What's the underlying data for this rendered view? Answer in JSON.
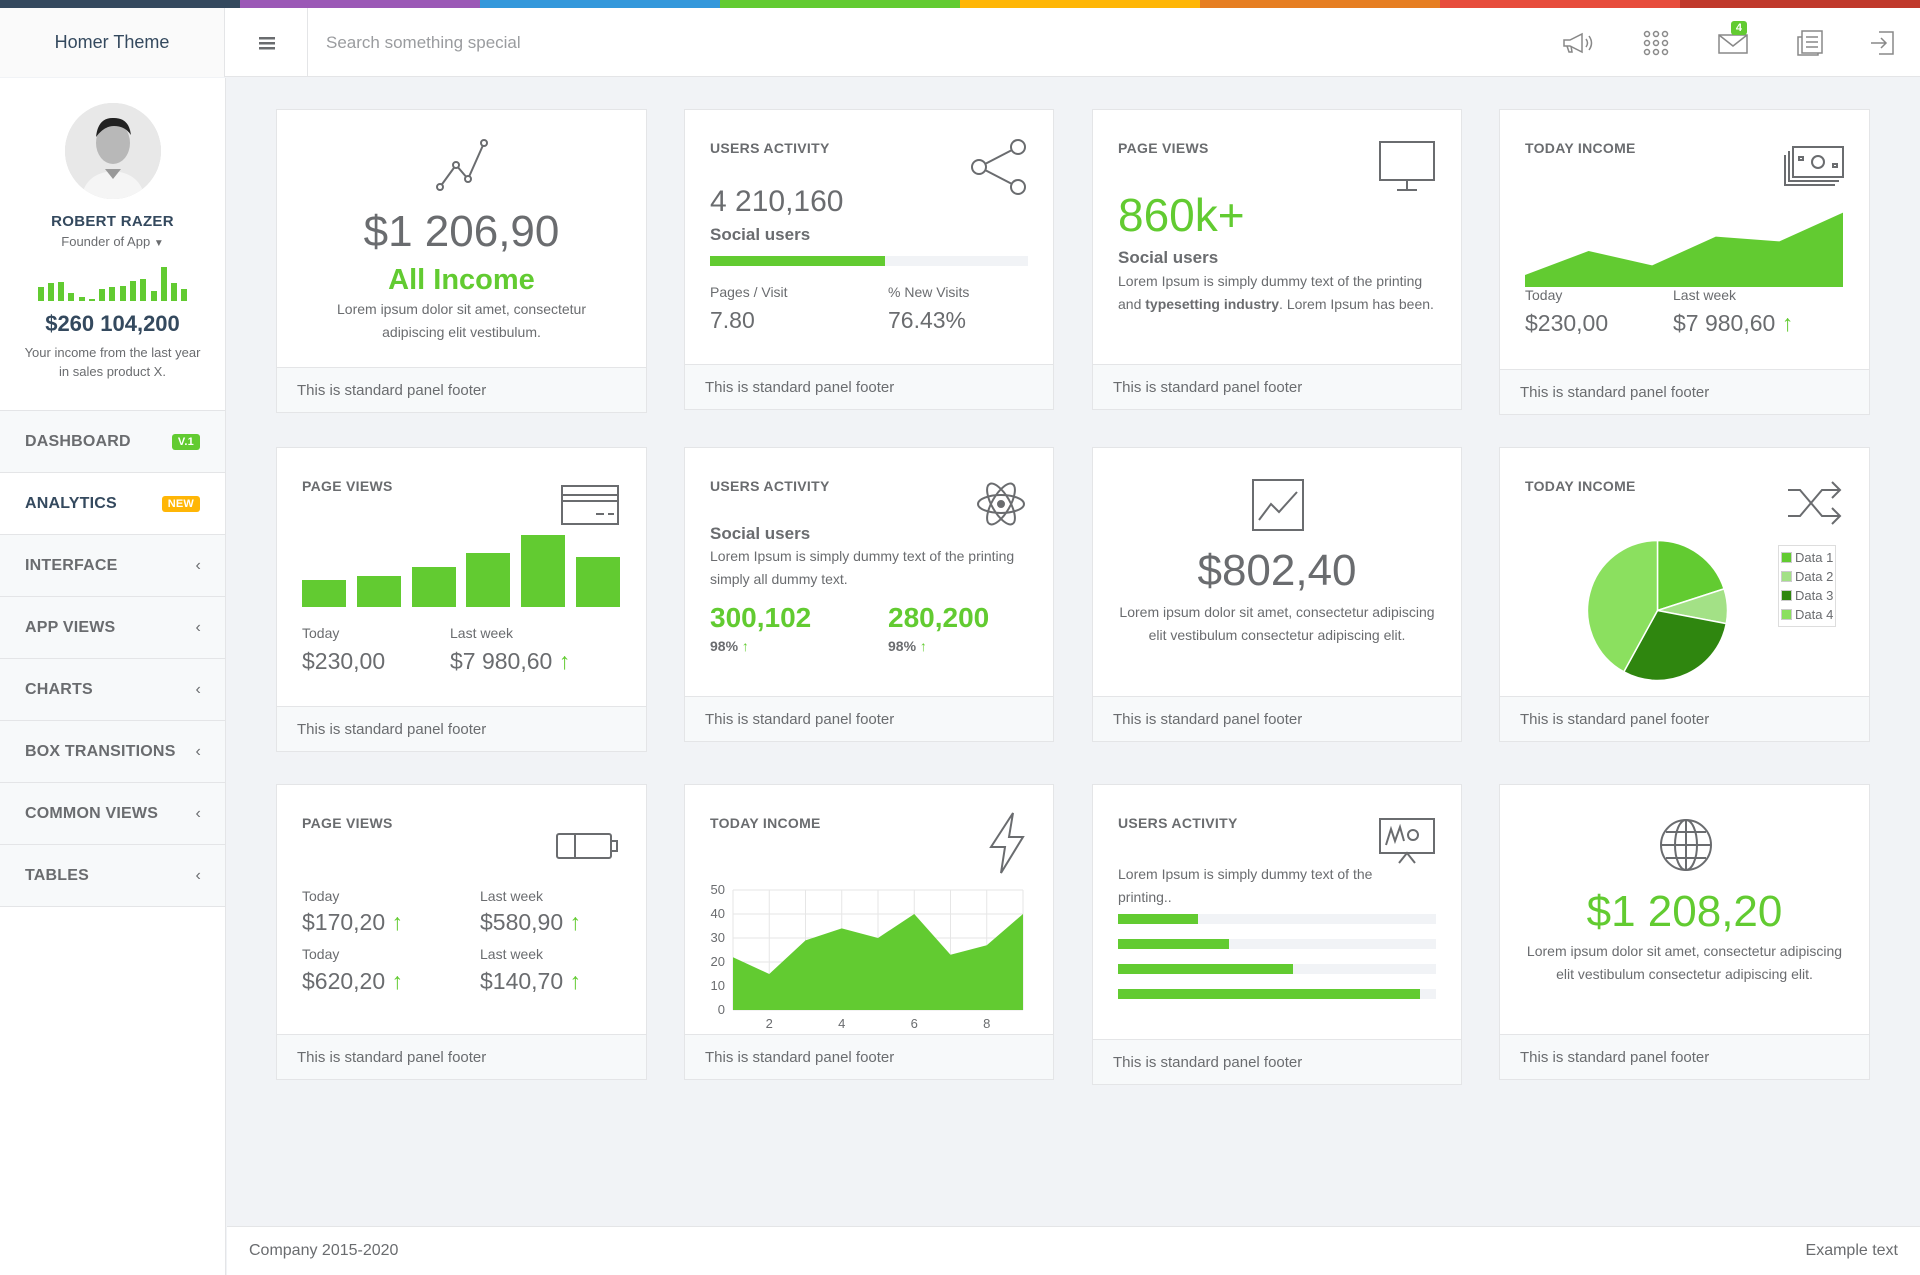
{
  "colorbar": [
    "#34495e",
    "#9b59b6",
    "#3498db",
    "#62cb31",
    "#ffb606",
    "#e67e22",
    "#e74c3c",
    "#c0392b"
  ],
  "header": {
    "brand": "Homer Theme",
    "search_placeholder": "Search something special",
    "mail_badge": "4"
  },
  "profile": {
    "name": "ROBERT RAZER",
    "role": "Founder of App",
    "income": "$260 104,200",
    "description": "Your income from the last year in sales product X.",
    "sparkline": [
      14,
      18,
      19,
      8,
      4,
      2,
      12,
      14,
      15,
      20,
      22,
      10,
      34,
      18,
      12
    ]
  },
  "nav": [
    {
      "label": "DASHBOARD",
      "badge": "V.1",
      "badge_color": "#62cb31"
    },
    {
      "label": "ANALYTICS",
      "badge": "NEW",
      "badge_color": "#ffb606"
    },
    {
      "label": "INTERFACE",
      "chevron": "‹"
    },
    {
      "label": "APP VIEWS",
      "chevron": "‹"
    },
    {
      "label": "CHARTS",
      "chevron": "‹"
    },
    {
      "label": "BOX TRANSITIONS",
      "chevron": "‹"
    },
    {
      "label": "COMMON VIEWS",
      "chevron": "‹"
    },
    {
      "label": "TABLES",
      "chevron": "‹"
    }
  ],
  "panel_footer": "This is standard panel footer",
  "p1": {
    "amount": "$1 206,90",
    "title": "All Income",
    "text": "Lorem ipsum dolor sit amet, consectetur adipiscing elit vestibulum."
  },
  "p2": {
    "title": "USERS ACTIVITY",
    "count": "4 210,160",
    "subtitle": "Social users",
    "progress": 0.55,
    "stat1_label": "Pages / Visit",
    "stat1_value": "7.80",
    "stat2_label": "% New Visits",
    "stat2_value": "76.43%"
  },
  "p3": {
    "title": "PAGE VIEWS",
    "value": "860k+",
    "subtitle": "Social users",
    "text_a": "Lorem Ipsum is simply dummy text of the printing and ",
    "text_b": "typesetting industry",
    "text_c": ". Lorem Ipsum has been."
  },
  "p4": {
    "title": "TODAY INCOME",
    "today_label": "Today",
    "today_value": "$230,00",
    "week_label": "Last week",
    "week_value": "$7 980,60",
    "area": [
      10,
      30,
      18,
      42,
      38,
      62
    ]
  },
  "p5": {
    "title": "PAGE VIEWS",
    "bars": [
      27,
      31,
      40,
      54,
      72,
      50
    ],
    "today_label": "Today",
    "today_value": "$230,00",
    "week_label": "Last week",
    "week_value": "$7 980,60"
  },
  "p6": {
    "title": "USERS ACTIVITY",
    "subtitle": "Social users",
    "text": "Lorem Ipsum is simply dummy text of the printing simply all dummy text.",
    "v1": "300,102",
    "p1": "98%",
    "v2": "280,200",
    "p2": "98%"
  },
  "p7": {
    "amount": "$802,40",
    "text": "Lorem ipsum dolor sit amet, consectetur adipiscing elit vestibulum consectetur adipiscing elit."
  },
  "p8": {
    "title": "TODAY INCOME",
    "legend": [
      "Data 1",
      "Data 2",
      "Data 3",
      "Data 4"
    ],
    "pie_colors": [
      "#62cb31",
      "#a3e186",
      "#2f860f",
      "#8be05f"
    ],
    "pie_values": [
      20,
      8,
      30,
      42
    ]
  },
  "p9": {
    "title": "PAGE VIEWS",
    "r1_l1": "Today",
    "r1_v1": "$170,20",
    "r1_l2": "Last week",
    "r1_v2": "$580,90",
    "r2_l1": "Today",
    "r2_v1": "$620,20",
    "r2_l2": "Last week",
    "r2_v2": "$140,70"
  },
  "p10": {
    "title": "TODAY INCOME"
  },
  "p11": {
    "title": "USERS ACTIVITY",
    "text": "Lorem Ipsum is simply dummy text of the printing..",
    "bars": [
      0.25,
      0.35,
      0.55,
      0.95
    ]
  },
  "p12": {
    "amount": "$1 208,20",
    "text": "Lorem ipsum dolor sit amet, consectetur adipiscing elit vestibulum consectetur adipiscing elit."
  },
  "chart_data": {
    "type": "area",
    "x": [
      1,
      2,
      3,
      4,
      5,
      6,
      7,
      8,
      9
    ],
    "values": [
      22,
      15,
      29,
      34,
      30,
      40,
      23,
      27,
      40
    ],
    "xticks": [
      "2",
      "4",
      "6",
      "8"
    ],
    "yticks": [
      "0",
      "10",
      "20",
      "30",
      "40",
      "50"
    ],
    "ylim": [
      0,
      50
    ],
    "grid": true
  },
  "footer": {
    "left": "Company 2015-2020",
    "right": "Example text"
  }
}
